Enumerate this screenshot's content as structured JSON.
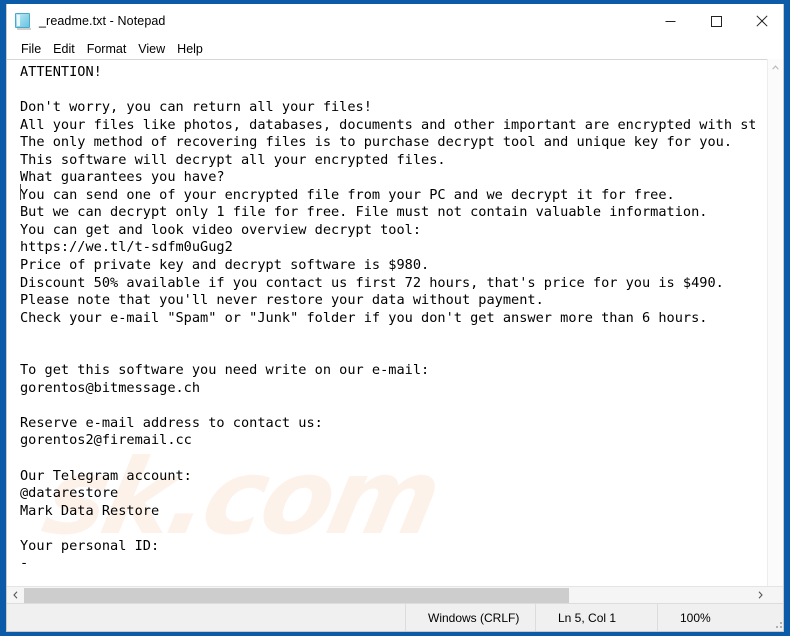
{
  "window": {
    "title": "_readme.txt - Notepad",
    "icon": "notepad-icon",
    "controls": {
      "minimize": "Minimize",
      "maximize": "Maximize",
      "close": "Close"
    },
    "border_color": "#0c5ba8"
  },
  "menu": {
    "items": [
      {
        "label": "File"
      },
      {
        "label": "Edit"
      },
      {
        "label": "Format"
      },
      {
        "label": "View"
      },
      {
        "label": "Help"
      }
    ]
  },
  "editor": {
    "watermark": "sk.com",
    "content": "ATTENTION!\n\nDon't worry, you can return all your files!\nAll your files like photos, databases, documents and other important are encrypted with strongest encryption and unique key.\nThe only method of recovering files is to purchase decrypt tool and unique key for you.\nThis software will decrypt all your encrypted files.\nWhat guarantees you have?\nYou can send one of your encrypted file from your PC and we decrypt it for free.\nBut we can decrypt only 1 file for free. File must not contain valuable information.\nYou can get and look video overview decrypt tool:\nhttps://we.tl/t-sdfm0uGug2\nPrice of private key and decrypt software is $980.\nDiscount 50% available if you contact us first 72 hours, that's price for you is $490.\nPlease note that you'll never restore your data without payment.\nCheck your e-mail \"Spam\" or \"Junk\" folder if you don't get answer more than 6 hours.\n\n\nTo get this software you need write on our e-mail:\ngorentos@bitmessage.ch\n\nReserve e-mail address to contact us:\ngorentos2@firemail.cc\n\nOur Telegram account:\n@datarestore\nMark Data Restore\n\nYour personal ID:\n-",
    "details": {
      "ransom_price": "$980",
      "discount_price": "$490",
      "discount_percent": "50%",
      "discount_window_hours": "72",
      "reply_window_hours": "6",
      "free_files": "1",
      "video_url": "https://we.tl/t-sdfm0uGug2",
      "email_primary": "gorentos@bitmessage.ch",
      "email_reserve": "gorentos2@firemail.cc",
      "telegram": "@datarestore",
      "telegram_name": "Mark Data Restore",
      "personal_id": "-"
    }
  },
  "statusbar": {
    "line_ending": "Windows (CRLF)",
    "cursor_position": "Ln 5, Col 1",
    "zoom": "100%"
  }
}
